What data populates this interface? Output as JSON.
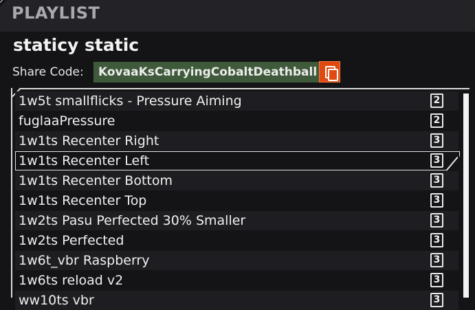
{
  "header": {
    "title": "PLAYLIST"
  },
  "playlist": {
    "name": "staticy static",
    "share_label": "Share Code:",
    "share_code": "KovaaKsCarryingCobaltDeathball",
    "copy_icon": "copy-icon"
  },
  "scenarios": [
    {
      "name": "1w5t smallflicks - Pressure Aiming",
      "count": "2"
    },
    {
      "name": "fuglaaPressure",
      "count": "2"
    },
    {
      "name": "1w1ts Recenter Right",
      "count": "3"
    },
    {
      "name": "1w1ts Recenter Left",
      "count": "3"
    },
    {
      "name": "1w1ts Recenter Bottom",
      "count": "3"
    },
    {
      "name": "1w1ts Recenter Top",
      "count": "3"
    },
    {
      "name": "1w2ts Pasu Perfected 30% Smaller",
      "count": "3"
    },
    {
      "name": "1w2ts Perfected",
      "count": "3"
    },
    {
      "name": "1w6t_vbr Raspberry",
      "count": "3"
    },
    {
      "name": "1w6ts reload v2",
      "count": "3"
    },
    {
      "name": "ww10ts vbr",
      "count": "3"
    }
  ],
  "selected_index": 3
}
